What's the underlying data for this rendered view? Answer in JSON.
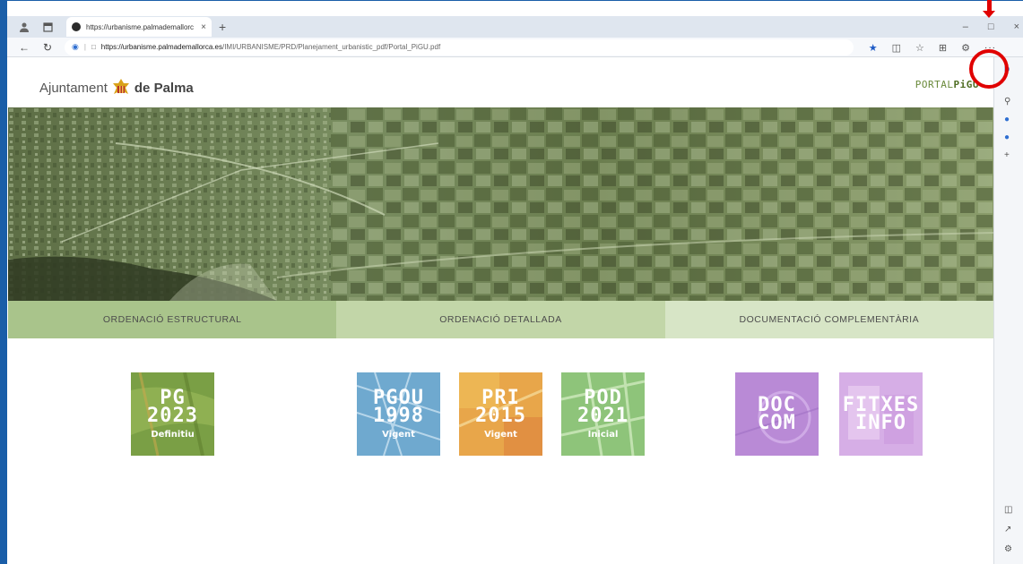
{
  "browser": {
    "tab_title": "https://urbanisme.palmademallorc",
    "tab_close": "×",
    "new_tab": "+",
    "url_domain": "https://urbanisme.palmademallorca.es",
    "url_path": "/IMI/URBANISME/PRD/Planejament_urbanistic_pdf/Portal_PiGU.pdf",
    "more_label": "···",
    "minimize": "–",
    "maximize": "□",
    "close": "×"
  },
  "header": {
    "logo_left_text": "Ajuntament",
    "logo_left_bold": "de Palma",
    "logo_right_prefix": "PORTAL",
    "logo_right_bold": "PiGU"
  },
  "menu": {
    "items": [
      {
        "label": "ORDENACIÓ ESTRUCTURAL"
      },
      {
        "label": "ORDENACIÓ DETALLADA"
      },
      {
        "label": "DOCUMENTACIÓ COMPLEMENTÀRIA"
      }
    ]
  },
  "tiles": [
    {
      "line1": "PG",
      "line2": "2023",
      "line3": "Definitiu",
      "color": "#7a9f45"
    },
    {
      "line1": "PGOU",
      "line2": "1998",
      "line3": "Vigent",
      "color": "#6fa9cf"
    },
    {
      "line1": "PRI",
      "line2": "2015",
      "line3": "Vigent",
      "color": "#e8a64a"
    },
    {
      "line1": "POD",
      "line2": "2021",
      "line3": "Inicial",
      "color": "#8ec47a"
    },
    {
      "line1": "DOC",
      "line2": "COM",
      "line3": "",
      "color": "#b98ad6"
    },
    {
      "line1": "FITXES",
      "line2": "INFO",
      "line3": "",
      "color": "#d6aee6"
    }
  ],
  "colors": {
    "accent_red": "#e00000",
    "menu_1": "#a9c48b",
    "menu_2": "#c2d6a8",
    "menu_3": "#d7e5c6"
  }
}
